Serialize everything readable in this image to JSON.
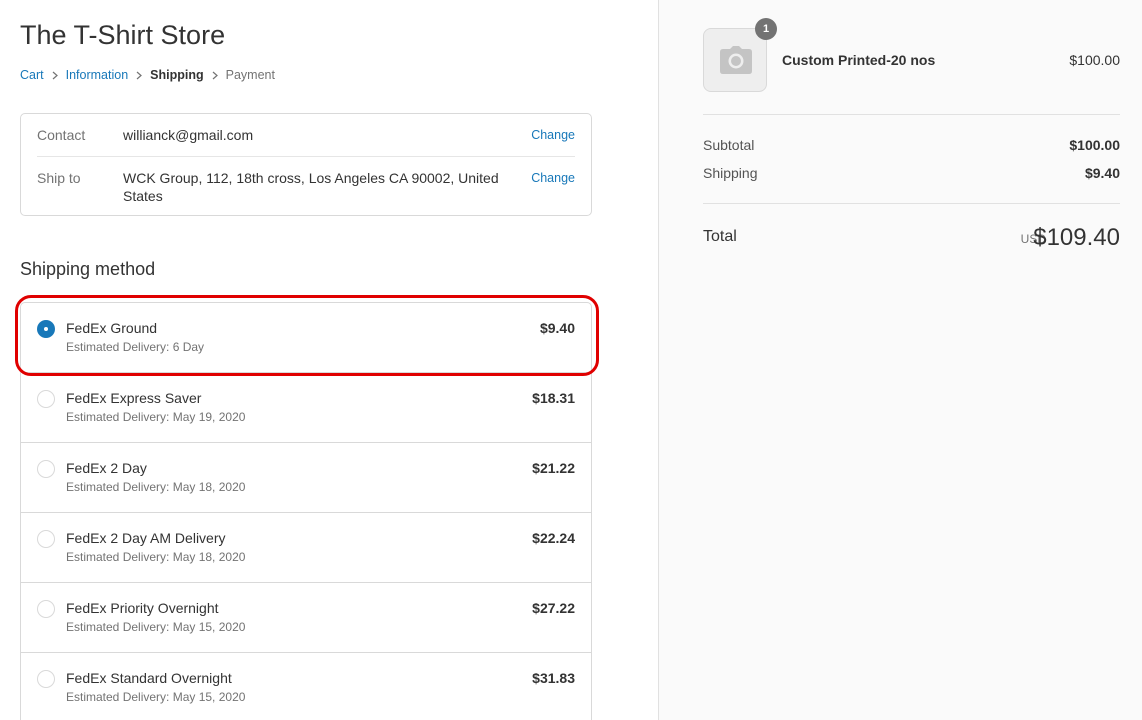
{
  "store": {
    "title": "The T-Shirt Store"
  },
  "breadcrumb": {
    "cart": "Cart",
    "information": "Information",
    "shipping": "Shipping",
    "payment": "Payment"
  },
  "review": {
    "contact_label": "Contact",
    "contact_value": "willianck@gmail.com",
    "ship_to_label": "Ship to",
    "ship_to_value": "WCK Group, 112, 18th cross, Los Angeles CA 90002, United States",
    "change_label": "Change"
  },
  "shipping": {
    "title": "Shipping method",
    "methods": [
      {
        "name": "FedEx Ground",
        "delivery": "Estimated Delivery: 6 Day",
        "price": "$9.40",
        "selected": true
      },
      {
        "name": "FedEx Express Saver",
        "delivery": "Estimated Delivery: May 19, 2020",
        "price": "$18.31",
        "selected": false
      },
      {
        "name": "FedEx 2 Day",
        "delivery": "Estimated Delivery: May 18, 2020",
        "price": "$21.22",
        "selected": false
      },
      {
        "name": "FedEx 2 Day AM Delivery",
        "delivery": "Estimated Delivery: May 18, 2020",
        "price": "$22.24",
        "selected": false
      },
      {
        "name": "FedEx Priority Overnight",
        "delivery": "Estimated Delivery: May 15, 2020",
        "price": "$27.22",
        "selected": false
      },
      {
        "name": "FedEx Standard Overnight",
        "delivery": "Estimated Delivery: May 15, 2020",
        "price": "$31.83",
        "selected": false
      }
    ]
  },
  "summary": {
    "product": {
      "name": "Custom Printed-20 nos",
      "price": "$100.00",
      "quantity": "1",
      "icon": "camera-icon"
    },
    "subtotal_label": "Subtotal",
    "subtotal_value": "$100.00",
    "shipping_label": "Shipping",
    "shipping_value": "$9.40",
    "total_label": "Total",
    "currency": "USD",
    "total_value": "$109.40"
  },
  "colors": {
    "accent": "#1878b9",
    "highlight": "#e00000",
    "sidebar_bg": "#fafafa"
  }
}
